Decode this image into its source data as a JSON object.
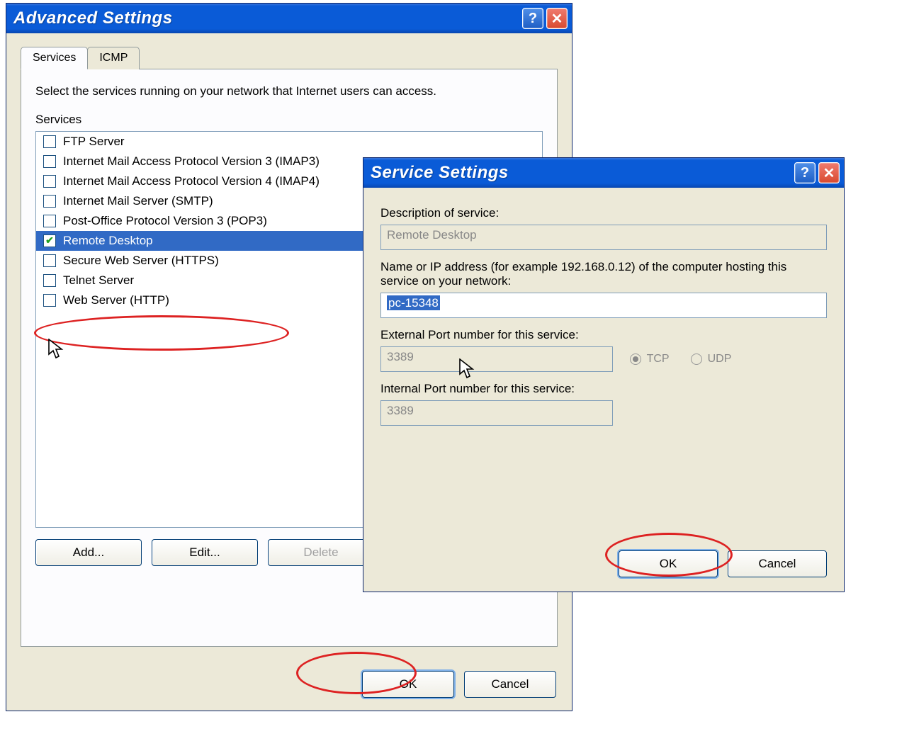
{
  "window1": {
    "title": "Advanced Settings",
    "tabs": {
      "t0": "Services",
      "t1": "ICMP"
    },
    "instruction": "Select the services running on your network that Internet users can access.",
    "list_label": "Services",
    "items": [
      {
        "label": "FTP Server",
        "checked": false
      },
      {
        "label": "Internet Mail Access Protocol Version 3 (IMAP3)",
        "checked": false
      },
      {
        "label": "Internet Mail Access Protocol Version 4 (IMAP4)",
        "checked": false
      },
      {
        "label": "Internet Mail Server (SMTP)",
        "checked": false
      },
      {
        "label": "Post-Office Protocol Version 3 (POP3)",
        "checked": false
      },
      {
        "label": "Remote Desktop",
        "checked": true,
        "selected": true
      },
      {
        "label": "Secure Web Server (HTTPS)",
        "checked": false
      },
      {
        "label": "Telnet Server",
        "checked": false
      },
      {
        "label": "Web Server (HTTP)",
        "checked": false
      }
    ],
    "buttons": {
      "add": "Add...",
      "edit": "Edit...",
      "delete": "Delete",
      "ok": "OK",
      "cancel": "Cancel"
    }
  },
  "window2": {
    "title": "Service Settings",
    "desc_label": "Description of service:",
    "desc_value": "Remote Desktop",
    "host_label": "Name or IP address (for example 192.168.0.12) of the computer hosting this service on your network:",
    "host_value": "pc-15348",
    "ext_port_label": "External Port number for this service:",
    "ext_port_value": "3389",
    "int_port_label": "Internal Port number for this service:",
    "int_port_value": "3389",
    "tcp": "TCP",
    "udp": "UDP",
    "ok": "OK",
    "cancel": "Cancel"
  }
}
